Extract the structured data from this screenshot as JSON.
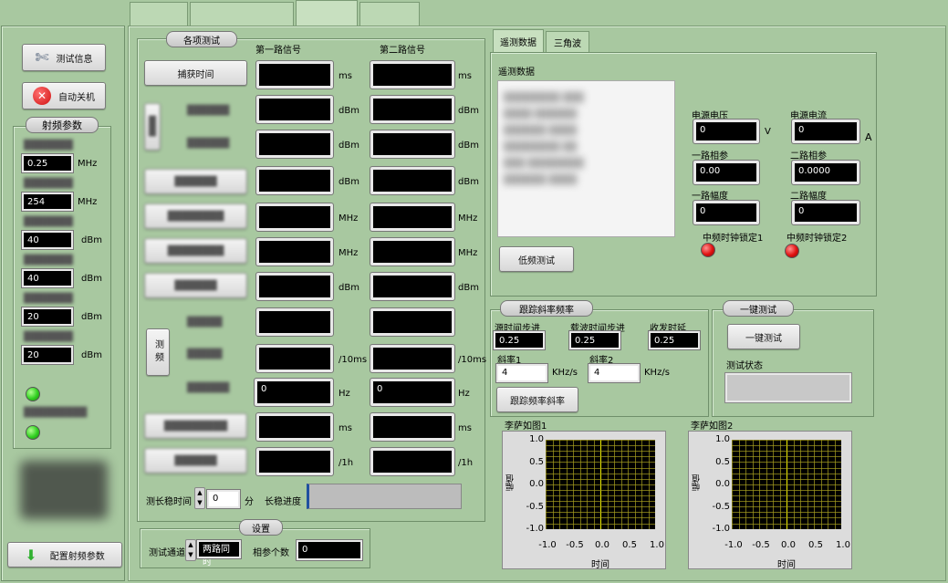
{
  "top_tabs": [
    {
      "label": ""
    },
    {
      "label": ""
    },
    {
      "label": ""
    },
    {
      "label": ""
    }
  ],
  "sidebar": {
    "test_info": "测试信息",
    "shutdown": "自动关机",
    "rf_params_title": "射频参数",
    "rf_values": [
      {
        "value": "0.25",
        "unit": "MHz"
      },
      {
        "value": "254",
        "unit": "MHz"
      },
      {
        "value": "40",
        "unit": "dBm"
      },
      {
        "value": "40",
        "unit": "dBm"
      },
      {
        "value": "20",
        "unit": "dBm"
      },
      {
        "value": "20",
        "unit": "dBm"
      }
    ],
    "config_rf": "配置射频参数"
  },
  "tests": {
    "caption": "各项测试",
    "col1": "第一路信号",
    "col2": "第二路信号",
    "capture_time": "捕获时间",
    "measure_freq": "测频",
    "rows": [
      {
        "u1": "ms",
        "u2": "ms"
      },
      {
        "u1": "dBm",
        "u2": "dBm"
      },
      {
        "u1": "dBm",
        "u2": "dBm"
      },
      {
        "u1": "dBm",
        "u2": "dBm"
      },
      {
        "u1": "MHz",
        "u2": "MHz"
      },
      {
        "u1": "MHz",
        "u2": "MHz"
      },
      {
        "u1": "dBm",
        "u2": "dBm"
      },
      {
        "u1": "",
        "u2": ""
      },
      {
        "u1": "/10ms",
        "u2": "/10ms"
      },
      {
        "u1": "Hz",
        "u2": "Hz",
        "v1": "0",
        "v2": "0"
      },
      {
        "u1": "ms",
        "u2": "ms"
      },
      {
        "u1": "/1h",
        "u2": "/1h"
      }
    ],
    "long_time_label": "测长稳时间",
    "long_time_value": "0",
    "long_time_unit": "分",
    "long_progress": "长稳进度"
  },
  "settings": {
    "caption": "设置",
    "channel_label": "测试通道",
    "channel_value": "两路同时",
    "phase_count_label": "相参个数",
    "phase_count_value": "0"
  },
  "right_tabs": [
    {
      "label": "遥测数据"
    },
    {
      "label": "三角波"
    }
  ],
  "telemetry": {
    "title": "遥测数据",
    "low_freq_btn": "低频测试",
    "voltage_label": "电源电压",
    "voltage": "0",
    "voltage_unit": "V",
    "current_label": "电源电流",
    "current": "0",
    "current_unit": "A",
    "phase1_label": "一路相参",
    "phase1": "0.00",
    "phase2_label": "二路相参",
    "phase2": "0.0000",
    "amp1_label": "一路幅度",
    "amp1": "0",
    "amp2_label": "二路幅度",
    "amp2": "0",
    "lock1_label": "中频时钟锁定1",
    "lock2_label": "中频时钟锁定2"
  },
  "slope": {
    "caption": "跟踪斜率频率",
    "source_step_label": "源时间步进",
    "source_step": "0.25",
    "carrier_step_label": "载波时间步进",
    "carrier_step": "0.25",
    "delay_label": "收发时延",
    "delay": "0.25",
    "slope1_label": "斜率1",
    "slope1": "4",
    "slope1_unit": "KHz/s",
    "slope2_label": "斜率2",
    "slope2": "4",
    "slope2_unit": "KHz/s",
    "btn": "跟踪频率斜率"
  },
  "onekey": {
    "caption": "一键测试",
    "btn": "一键测试",
    "status_label": "测试状态"
  },
  "lissajous": [
    {
      "title": "李萨如图1",
      "xlabel": "时间",
      "ylabel": "幅值"
    },
    {
      "title": "李萨如图2",
      "xlabel": "时间",
      "ylabel": "幅值"
    }
  ],
  "axis_ticks": [
    "1.0",
    "0.5",
    "0.0",
    "-0.5",
    "-1.0"
  ],
  "x_ticks": [
    "-1.0",
    "-0.5",
    "0.0",
    "0.5",
    "1.0"
  ],
  "colors": {
    "bg": "#a8c8a0",
    "grid": "#a8a020",
    "cursor": "#f0f000"
  }
}
